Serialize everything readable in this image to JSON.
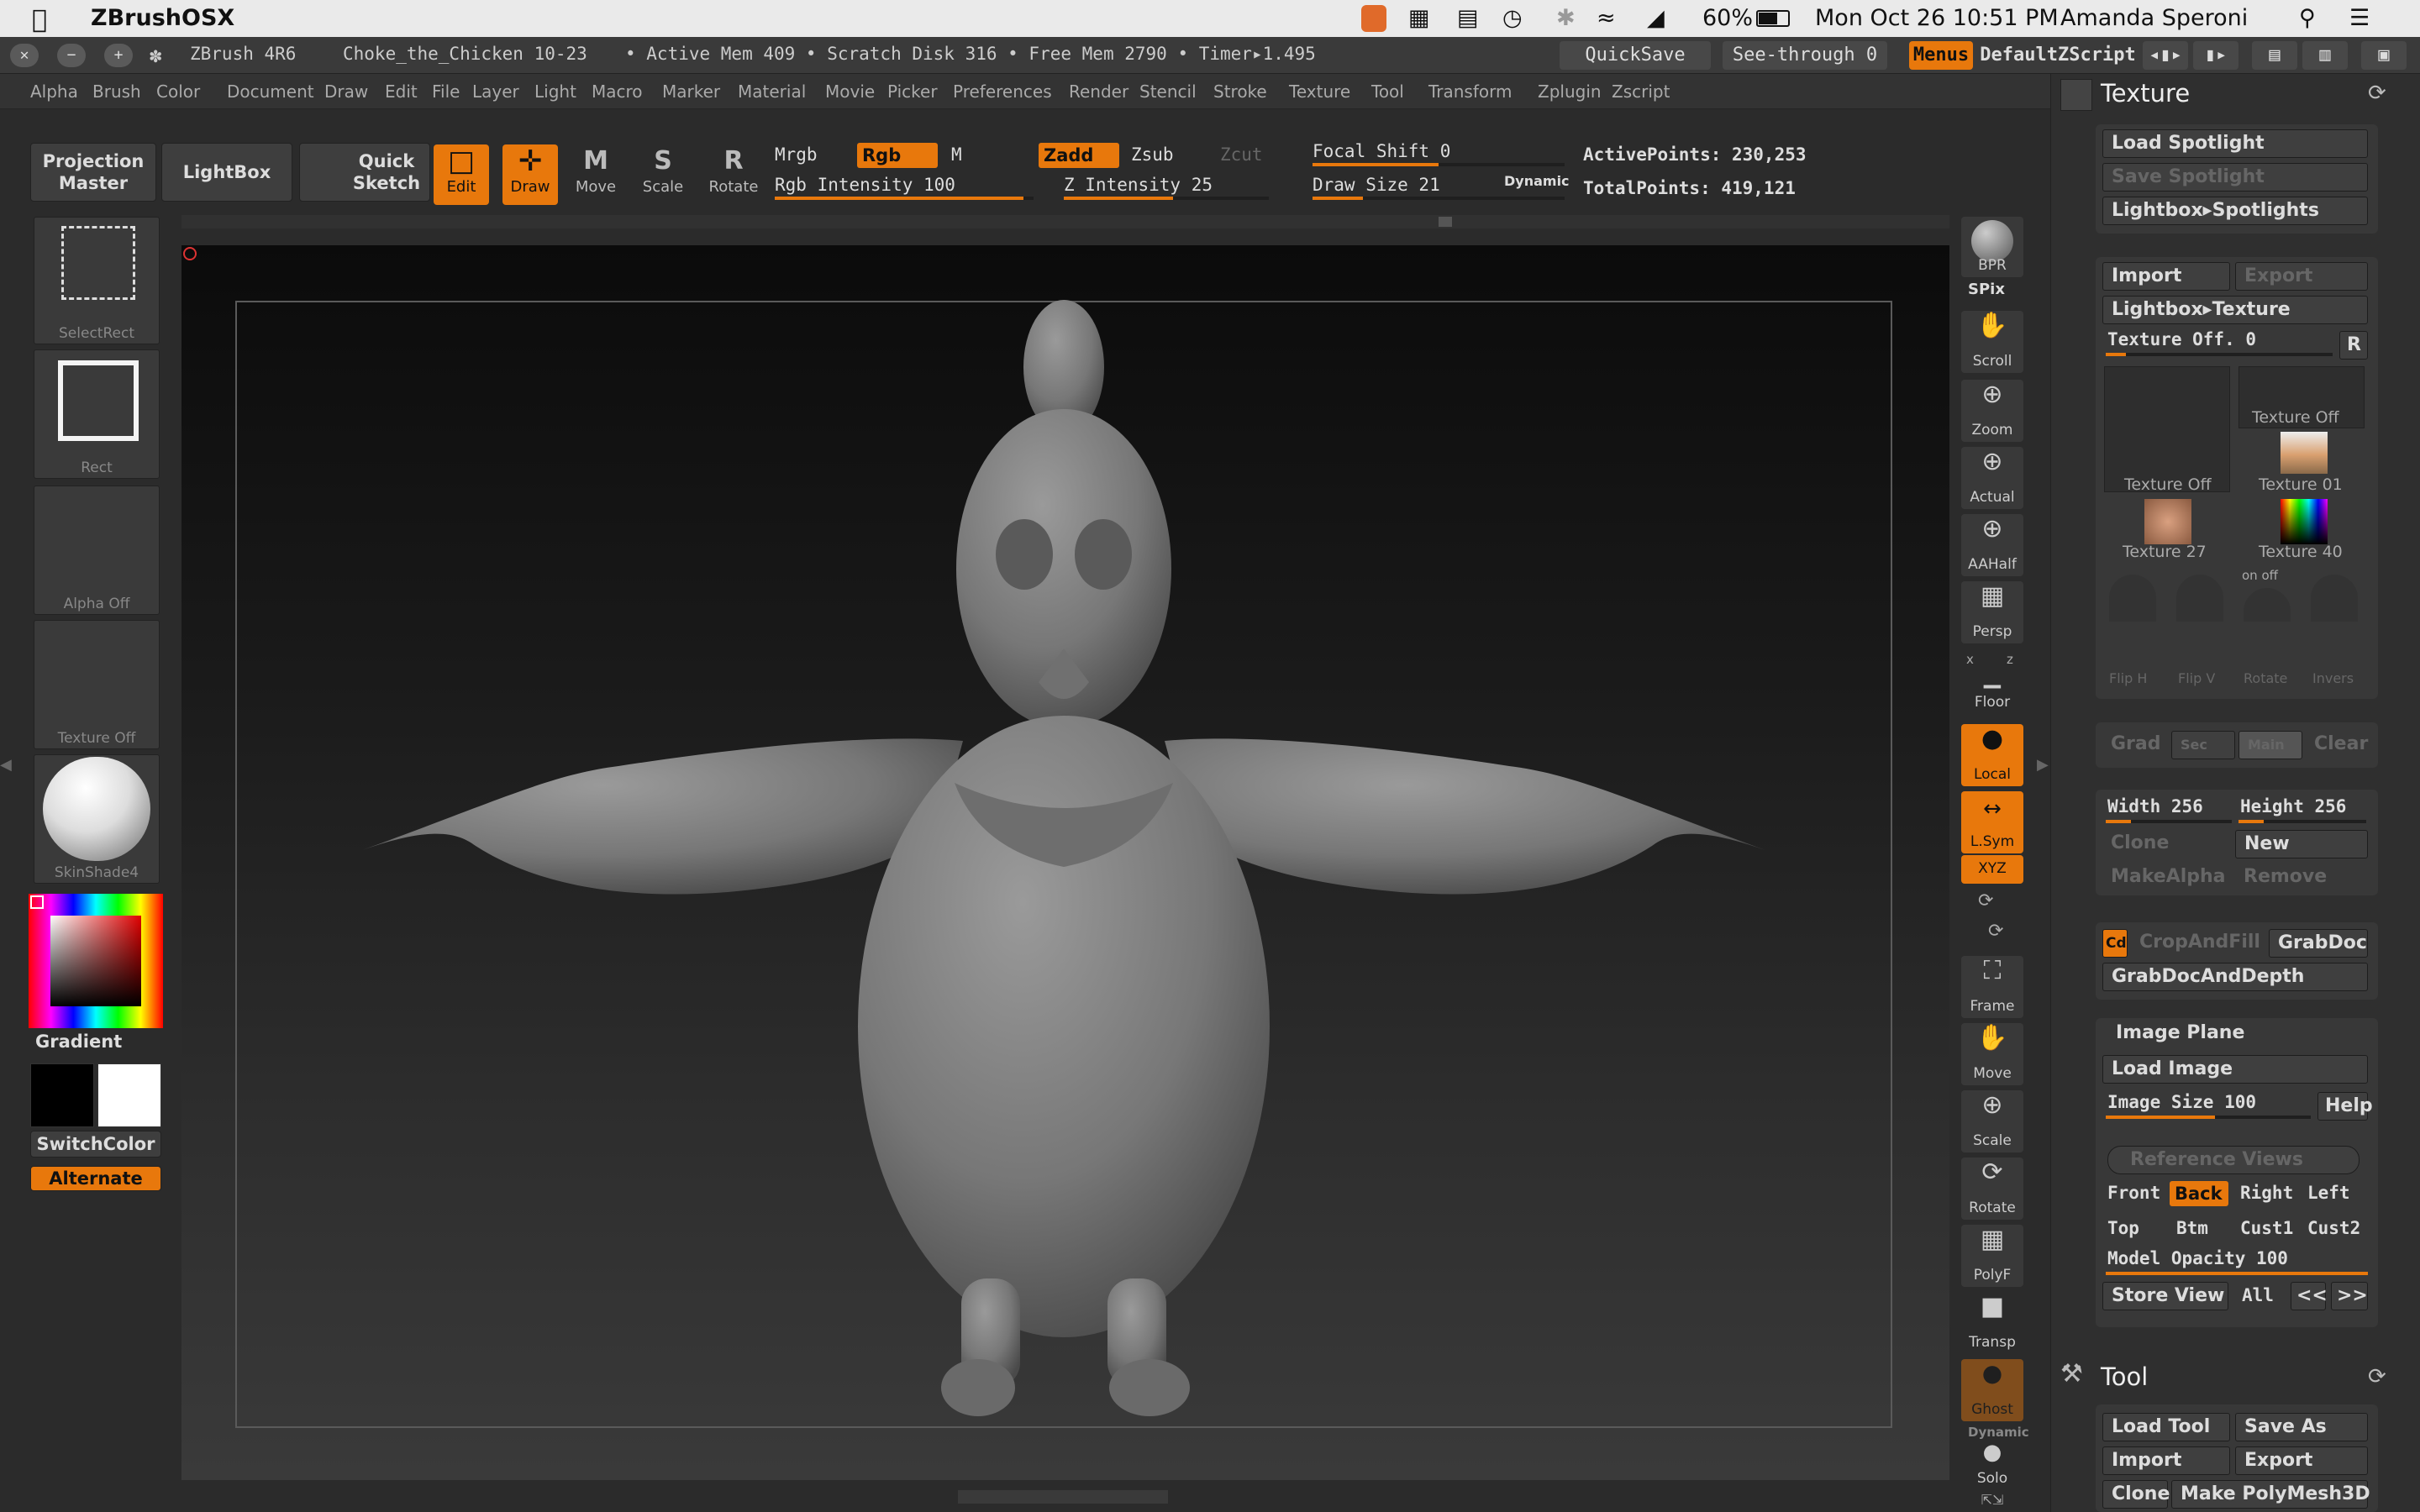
{
  "macbar": {
    "app_name": "ZBrushOSX",
    "battery": "60%",
    "datetime": "Mon Oct 26  10:51 PM",
    "user": "Amanda Speroni"
  },
  "titlebar": {
    "version": "ZBrush 4R6",
    "document": "Choke_the_Chicken 10-23",
    "stats": "• Active Mem 409 • Scratch Disk 316 • Free Mem 2790 • Timer▸1.495",
    "quicksave": "QuickSave",
    "seethrough": "See-through  0",
    "menus": "Menus",
    "zscript": "DefaultZScript"
  },
  "menus": [
    "Alpha",
    "Brush",
    "Color",
    "Document",
    "Draw",
    "Edit",
    "File",
    "Layer",
    "Light",
    "Macro",
    "Marker",
    "Material",
    "Movie",
    "Picker",
    "Preferences",
    "Render",
    "Stencil",
    "Stroke",
    "Texture",
    "Tool",
    "Transform",
    "Zplugin",
    "Zscript"
  ],
  "shelf": {
    "projection_master": "Projection Master",
    "lightbox": "LightBox",
    "quick_sketch": "Quick Sketch",
    "edit": "Edit",
    "draw": "Draw",
    "move": "Move",
    "scale": "Scale",
    "rotate": "Rotate",
    "mrgb": "Mrgb",
    "rgb": "Rgb",
    "m": "M",
    "zadd": "Zadd",
    "zsub": "Zsub",
    "zcut": "Zcut",
    "rgb_intensity": "Rgb  Intensity 100",
    "z_intensity": "Z  Intensity 25",
    "focal_shift": "Focal  Shift 0",
    "draw_size": "Draw  Size 21",
    "dynamic": "Dynamic",
    "active_points": "ActivePoints: 230,253",
    "total_points": "TotalPoints: 419,121"
  },
  "left": {
    "selectrect": "SelectRect",
    "rect": "Rect",
    "alpha": "Alpha  Off",
    "texture": "Texture  Off",
    "material": "SkinShade4",
    "gradient": "Gradient",
    "switchcolor": "SwitchColor",
    "alternate": "Alternate"
  },
  "rightstrip": [
    "BPR",
    "SPix",
    "Scroll",
    "Zoom",
    "Actual",
    "AAHalf",
    "Persp",
    "Floor",
    "Local",
    "L.Sym",
    "XYZ",
    "Frame",
    "Move",
    "Scale",
    "Rotate",
    "PolyF",
    "Transp",
    "Ghost",
    "Solo"
  ],
  "rightstrip_extra": {
    "dynamic": "Dynamic",
    "xpose_a": "x",
    "xpose_b": "z"
  },
  "texture_panel": {
    "title": "Texture",
    "load_spotlight": "Load Spotlight",
    "save_spotlight": "Save Spotlight",
    "lightbox_spotlights": "Lightbox▸Spotlights",
    "import": "Import",
    "export": "Export",
    "lightbox_texture": "Lightbox▸Texture",
    "texture_off": "Texture  Off. 0",
    "r": "R",
    "thumb_off1": "Texture  Off",
    "thumb_off2": "Texture  Off",
    "thumb_01": "Texture  01",
    "thumb_27": "Texture  27",
    "thumb_40": "Texture  40",
    "onoff": "on  off",
    "flip_h": "Flip H",
    "flip_v": "Flip V",
    "rotate": "Rotate",
    "invers": "Invers",
    "grad": "Grad",
    "sec": "Sec",
    "main": "Main",
    "clear": "Clear",
    "width": "Width 256",
    "height": "Height 256",
    "clone": "Clone",
    "new": "New",
    "makealpha": "MakeAlpha",
    "remove": "Remove",
    "cd": "Cd",
    "cropandfill": "CropAndFill",
    "grabdoc": "GrabDoc",
    "grabdocanddepth": "GrabDocAndDepth",
    "image_plane": "Image Plane",
    "load_image": "Load Image",
    "image_size": "Image  Size 100",
    "help": "Help",
    "reference_views": "Reference Views",
    "views": [
      "Front",
      "Back",
      "Right",
      "Left",
      "Top",
      "Btm",
      "Cust1",
      "Cust2"
    ],
    "model_opacity": "Model  Opacity 100",
    "store_view": "Store View",
    "all": "All",
    "prev": "<<",
    "next": ">>"
  },
  "tool_panel": {
    "title": "Tool",
    "load_tool": "Load Tool",
    "save_as": "Save As",
    "import": "Import",
    "export": "Export",
    "clone": "Clone",
    "make_polymesh": "Make PolyMesh3D"
  },
  "colors": {
    "accent": "#e8780c",
    "panel": "#2f2f2f"
  }
}
